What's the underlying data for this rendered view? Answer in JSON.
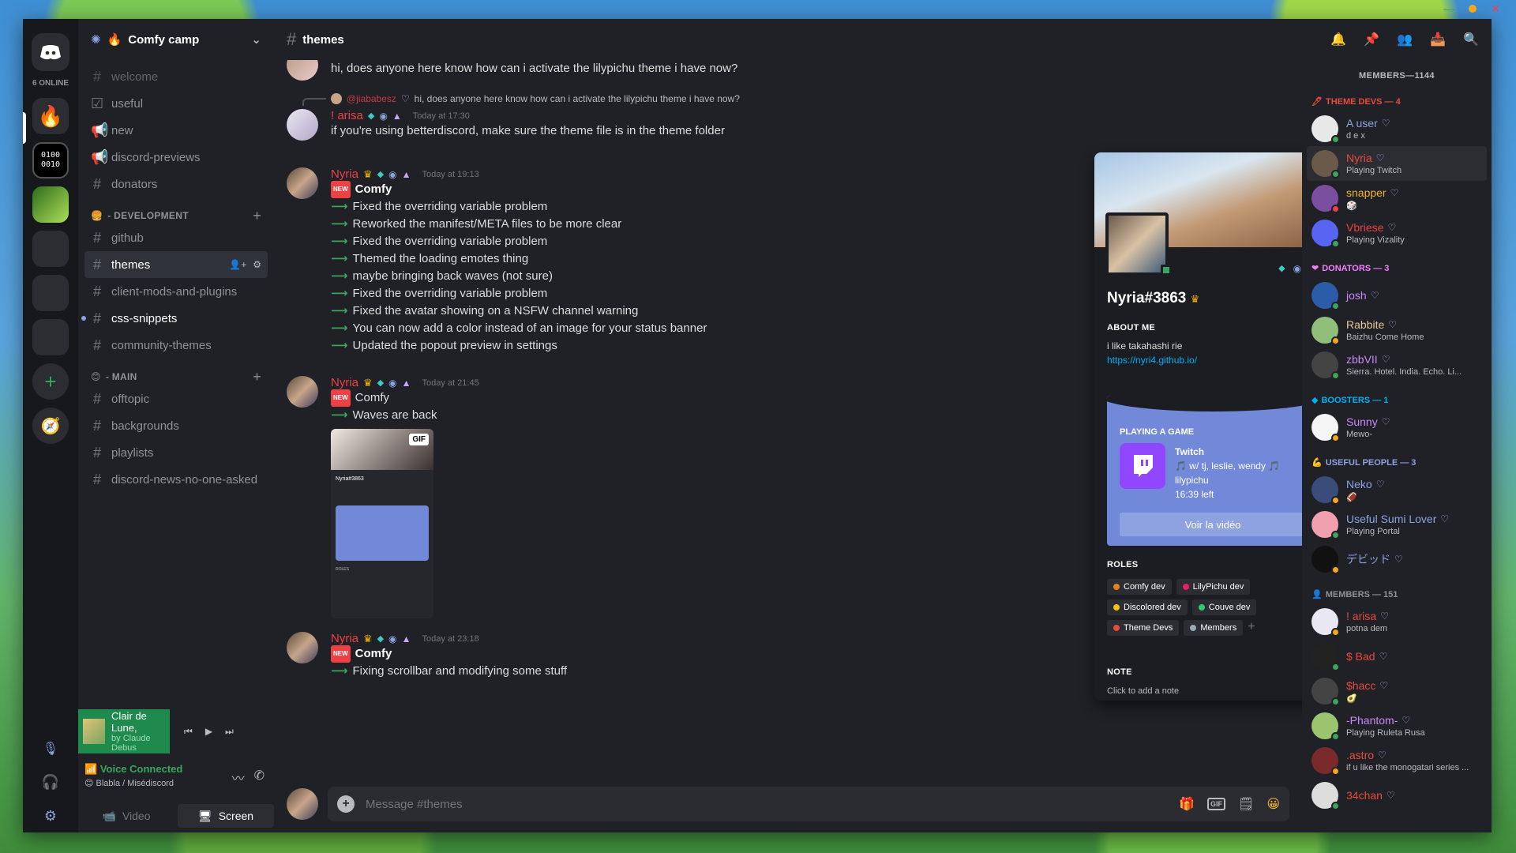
{
  "window": {
    "close_color": "#ed4245",
    "min_color": "#3ba55d",
    "max_color": "#faa61a"
  },
  "rail": {
    "online": "6 ONLINE",
    "servers": [
      {
        "name": "comfy-camp",
        "bg": "#f8b400",
        "label": ""
      },
      {
        "name": "binary",
        "bg": "#111111",
        "label": "0100 0010"
      },
      {
        "name": "game",
        "bg": "#3d8a2a",
        "label": ""
      },
      {
        "name": "folder-1",
        "bg": "#2b2d33",
        "label": ""
      },
      {
        "name": "folder-2",
        "bg": "#2b2d33",
        "label": ""
      },
      {
        "name": "folder-3",
        "bg": "#2b2d33",
        "label": ""
      }
    ]
  },
  "guild": {
    "name": "Comfy camp"
  },
  "channels": {
    "top": [
      {
        "name": "welcome",
        "icon": "#",
        "state": "muted"
      },
      {
        "name": "useful",
        "icon": "☑",
        "state": ""
      },
      {
        "name": "new",
        "icon": "📢",
        "state": ""
      },
      {
        "name": "discord-previews",
        "icon": "📢",
        "state": ""
      },
      {
        "name": "donators",
        "icon": "#",
        "state": ""
      }
    ],
    "dev_category": "- DEVELOPMENT",
    "dev": [
      {
        "name": "github",
        "icon": "#",
        "state": ""
      },
      {
        "name": "themes",
        "icon": "#",
        "state": "active"
      },
      {
        "name": "client-mods-and-plugins",
        "icon": "#",
        "state": ""
      },
      {
        "name": "css-snippets",
        "icon": "#",
        "state": "unread"
      },
      {
        "name": "community-themes",
        "icon": "#",
        "state": ""
      }
    ],
    "main_category": "- MAIN",
    "main": [
      {
        "name": "offtopic",
        "icon": "#",
        "state": ""
      },
      {
        "name": "backgrounds",
        "icon": "#",
        "state": ""
      },
      {
        "name": "playlists",
        "icon": "#",
        "state": ""
      },
      {
        "name": "discord-news-no-one-asked",
        "icon": "#",
        "state": ""
      }
    ]
  },
  "player": {
    "title": "Clair de Lune,",
    "artist": "by Claude Debus"
  },
  "voice": {
    "status": "Voice Connected",
    "channel": "Blabla / Misédiscord",
    "video": "Video",
    "screen": "Screen"
  },
  "topbar": {
    "channel": "themes"
  },
  "messages": {
    "jia_partial": "hi, does anyone here know how can i activate the lilypichu theme i have now?",
    "reply_user": "@jiababesz",
    "reply_text": "hi, does anyone here know how can i activate the lilypichu theme i have now?",
    "arisa": {
      "name": "! arisa",
      "time": "Today at 17:30",
      "text": "if you're using betterdiscord, make sure the theme file is in the theme folder"
    },
    "nyria1": {
      "name": "Nyria",
      "time": "Today at 19:13",
      "head": "Comfy",
      "lines": [
        "Fixed the overriding variable problem",
        "Reworked the manifest/META files to be more clear",
        "Fixed the overriding variable problem",
        "Themed the loading emotes thing",
        "maybe bringing back waves (not sure)",
        "Fixed the overriding variable problem",
        "Fixed the avatar showing on a NSFW channel warning",
        "You can now add a color instead of an image for your status banner",
        "Updated the popout preview in settings"
      ]
    },
    "nyria2": {
      "name": "Nyria",
      "time": "Today at 21:45",
      "head": "Comfy",
      "lines": [
        "Waves are back"
      ],
      "gif": "GIF"
    },
    "nyria3": {
      "name": "Nyria",
      "time": "Today at 23:18",
      "head": "Comfy",
      "lines": [
        "Fixing scrollbar and modifying some stuff"
      ]
    },
    "new_tag": "NEW"
  },
  "composer": {
    "placeholder": "Message #themes",
    "gif": "GIF"
  },
  "popout": {
    "name": "Nyria#3863",
    "about_h": "ABOUT ME",
    "about": "i like takahashi rie",
    "link": "https://nyri4.github.io/",
    "game_h": "PLAYING A GAME",
    "game": "Twitch",
    "game_l1": "🎵 w/ tj, leslie, wendy 🎵",
    "game_l2": "lilypichu",
    "game_l3": "16:39 left",
    "game_btn": "Voir la vidéo",
    "roles_h": "ROLES",
    "roles": [
      {
        "name": "Comfy dev",
        "color": "#e67e22"
      },
      {
        "name": "LilyPichu dev",
        "color": "#e91e63"
      },
      {
        "name": "Discolored dev",
        "color": "#f1c40f"
      },
      {
        "name": "Couve dev",
        "color": "#2ecc71"
      },
      {
        "name": "Theme Devs",
        "color": "#e74c3c"
      },
      {
        "name": "Members",
        "color": "#99aab5"
      }
    ],
    "note_h": "NOTE",
    "note": "Click to add a note"
  },
  "members": {
    "title": "MEMBERS—1144",
    "groups": [
      {
        "label": "THEME DEVS — 4",
        "color": "#e74c3c",
        "icon": "🖊",
        "items": [
          {
            "name": "A user",
            "color": "#8ea1e1",
            "sub": "d e x",
            "status": "#3ba55d",
            "av": "#e8e8e8"
          },
          {
            "name": "Nyria",
            "color": "#e74c3c",
            "sub": "Playing Twitch",
            "status": "#3ba55d",
            "av": "#6b5a4a"
          },
          {
            "name": "snapper",
            "color": "#f0b232",
            "sub": "🎲",
            "status": "#ed4245",
            "av": "#7a4fa0"
          },
          {
            "name": "Vbriese",
            "color": "#ed4245",
            "sub": "Playing Vizality",
            "status": "#3ba55d",
            "av": "#5865f2"
          }
        ]
      },
      {
        "label": "DONATORS — 3",
        "color": "#f47fff",
        "icon": "❤",
        "items": [
          {
            "name": "josh",
            "color": "#c78af7",
            "sub": "",
            "status": "#3ba55d",
            "av": "#2b5ca8"
          },
          {
            "name": "Rabbite",
            "color": "#e6c89a",
            "sub": "Baizhu Come Home",
            "status": "#faa61a",
            "av": "#8fbf7a"
          },
          {
            "name": "zbbVII",
            "color": "#c78af7",
            "sub": "Sierra. Hotel. India. Echo. Li...",
            "status": "#3ba55d",
            "av": "#444"
          }
        ]
      },
      {
        "label": "BOOSTERS — 1",
        "color": "#00b0f4",
        "icon": "◆",
        "items": [
          {
            "name": "Sunny",
            "color": "#c78af7",
            "sub": "Mewo-",
            "status": "#faa61a",
            "av": "#f5f5f5"
          }
        ]
      },
      {
        "label": "USEFUL PEOPLE — 3",
        "color": "#8ea1e1",
        "icon": "💪",
        "items": [
          {
            "name": "Neko",
            "color": "#8ea1e1",
            "sub": "🏈",
            "status": "#faa61a",
            "av": "#3a4c7a"
          },
          {
            "name": "Useful Sumi Lover",
            "color": "#8ea1e1",
            "sub": "Playing Portal",
            "status": "#3ba55d",
            "av": "#f1a0b0"
          },
          {
            "name": "デビッド",
            "color": "#8ea1e1",
            "sub": "",
            "status": "#faa61a",
            "av": "#111"
          }
        ]
      },
      {
        "label": "MEMBERS — 151",
        "color": "#8e9297",
        "icon": "👤",
        "items": [
          {
            "name": "! arisa",
            "color": "#e74c3c",
            "sub": "potna dem",
            "status": "#faa61a",
            "av": "#e9e7f2"
          },
          {
            "name": "$ Bad",
            "color": "#e74c3c",
            "sub": "",
            "status": "#3ba55d",
            "av": "#222"
          },
          {
            "name": "$hacc",
            "color": "#e74c3c",
            "sub": "🥑",
            "status": "#3ba55d",
            "av": "#444"
          },
          {
            "name": "-Phantom-",
            "color": "#c78af7",
            "sub": "Playing Ruleta Rusa",
            "status": "#3ba55d",
            "av": "#9ac46e"
          },
          {
            "name": ".astro",
            "color": "#e74c3c",
            "sub": "if u like the monogatari series ...",
            "status": "#faa61a",
            "av": "#7a2a2a"
          },
          {
            "name": "34chan",
            "color": "#e74c3c",
            "sub": "",
            "status": "#3ba55d",
            "av": "#ddd"
          }
        ]
      }
    ]
  }
}
